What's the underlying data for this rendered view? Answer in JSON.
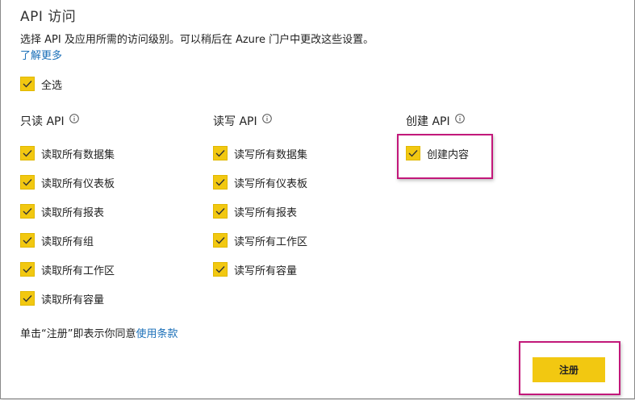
{
  "header": {
    "title": "API 访问",
    "description": "选择 API 及应用所需的访问级别。可以稍后在 Azure 门户中更改这些设置。",
    "learn_more": "了解更多"
  },
  "select_all": {
    "label": "全选",
    "checked": true
  },
  "columns": [
    {
      "heading": "只读 API",
      "items": [
        {
          "label": "读取所有数据集",
          "checked": true
        },
        {
          "label": "读取所有仪表板",
          "checked": true
        },
        {
          "label": "读取所有报表",
          "checked": true
        },
        {
          "label": "读取所有组",
          "checked": true
        },
        {
          "label": "读取所有工作区",
          "checked": true
        },
        {
          "label": "读取所有容量",
          "checked": true
        }
      ]
    },
    {
      "heading": "读写 API",
      "items": [
        {
          "label": "读写所有数据集",
          "checked": true
        },
        {
          "label": "读写所有仪表板",
          "checked": true
        },
        {
          "label": "读写所有报表",
          "checked": true
        },
        {
          "label": "读写所有工作区",
          "checked": true
        },
        {
          "label": "读写所有容量",
          "checked": true
        }
      ]
    },
    {
      "heading": "创建 API",
      "items": [
        {
          "label": "创建内容",
          "checked": true
        }
      ]
    }
  ],
  "footer": {
    "terms_prefix": "单击“注册”即表示你同意",
    "terms_link": "使用条款",
    "register_button": "注册"
  },
  "colors": {
    "checkbox_fill": "#f2c811",
    "link": "#1a6fb8",
    "highlight": "#c2187a"
  }
}
